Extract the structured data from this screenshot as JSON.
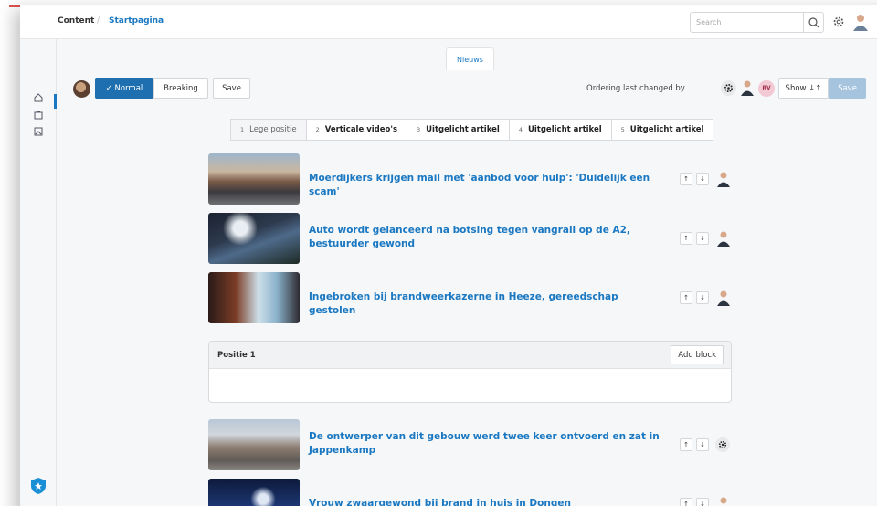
{
  "header": {
    "breadcrumb_root": "Content",
    "breadcrumb_sep": "/",
    "breadcrumb_page": "Startpagina",
    "search_placeholder": "Search"
  },
  "tabs": [
    {
      "label": "Nieuws",
      "active": true
    }
  ],
  "toolbar": {
    "mode_normal": "Normal",
    "mode_normal_check": "✓",
    "mode_breaking": "Breaking",
    "save_label": "Save",
    "ordering_text": "Ordering last changed by",
    "rv_initials": "RV",
    "show_label": "Show ↓↑",
    "save_right_label": "Save"
  },
  "positions": [
    {
      "num": "1",
      "label": "Lege positie"
    },
    {
      "num": "2",
      "label": "Verticale video's"
    },
    {
      "num": "3",
      "label": "Uitgelicht artikel"
    },
    {
      "num": "4",
      "label": "Uitgelicht artikel"
    },
    {
      "num": "5",
      "label": "Uitgelicht artikel"
    }
  ],
  "articles": [
    {
      "title": "Moerdijkers krijgen mail met 'aanbod voor hulp': 'Duidelijk een scam'"
    },
    {
      "title": "Auto wordt gelanceerd na botsing tegen vangrail op de A2, bestuurder gewond"
    },
    {
      "title": "Ingebroken bij brandweerkazerne in Heeze, gereedschap gestolen"
    },
    {
      "title": "De ontwerper van dit gebouw werd twee keer ontvoerd en zat in Jappenkamp"
    },
    {
      "title": "Vrouw zwaargewond bij brand in huis in Dongen"
    }
  ],
  "block": {
    "title": "Positie 1",
    "add_label": "Add block"
  },
  "arrows": {
    "up": "↑",
    "down": "↓"
  },
  "colors": {
    "accent": "#1a78c2",
    "primary_button": "#1e6fb0",
    "disabled_save": "#a7c4df"
  }
}
